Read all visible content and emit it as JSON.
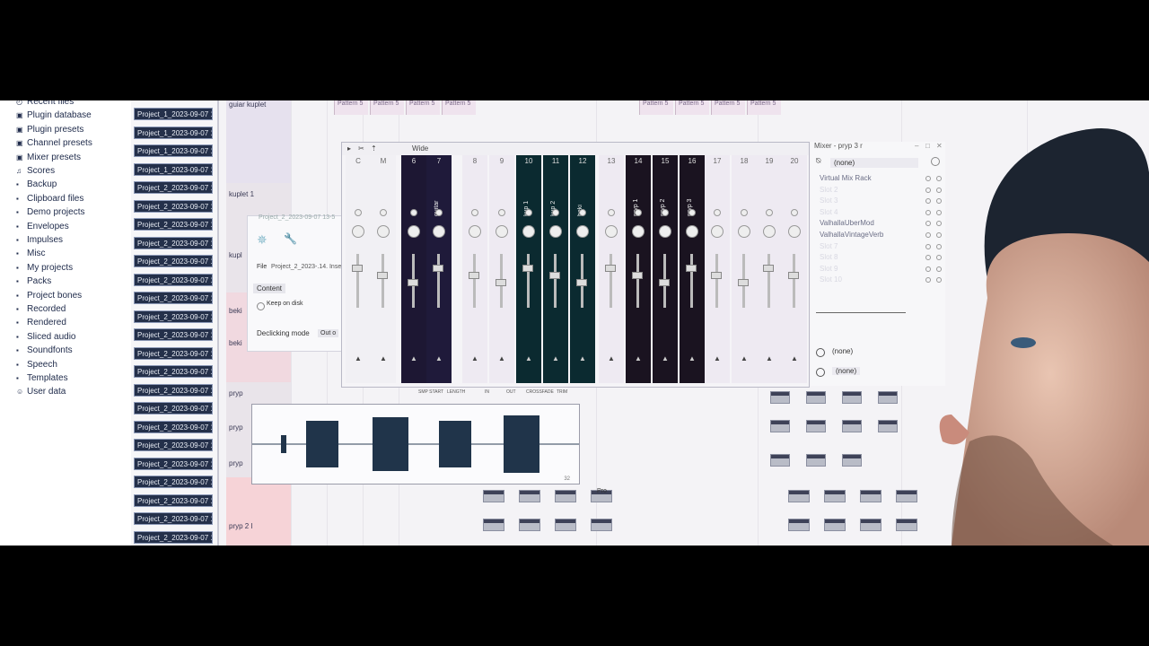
{
  "browser": {
    "items": [
      {
        "label": "Recent files",
        "icon": "clock-icon"
      },
      {
        "label": "Plugin database",
        "icon": "plug-icon"
      },
      {
        "label": "Plugin presets",
        "icon": "plug-icon"
      },
      {
        "label": "Channel presets",
        "icon": "plug-icon"
      },
      {
        "label": "Mixer presets",
        "icon": "plug-icon"
      },
      {
        "label": "Scores",
        "icon": "note-icon"
      },
      {
        "label": "Backup",
        "icon": "folder-icon"
      },
      {
        "label": "Clipboard files",
        "icon": "folder-icon"
      },
      {
        "label": "Demo projects",
        "icon": "folder-icon"
      },
      {
        "label": "Envelopes",
        "icon": "folder-icon"
      },
      {
        "label": "Impulses",
        "icon": "folder-icon"
      },
      {
        "label": "Misc",
        "icon": "folder-icon"
      },
      {
        "label": "My projects",
        "icon": "folder-icon"
      },
      {
        "label": "Packs",
        "icon": "folder-icon"
      },
      {
        "label": "Project bones",
        "icon": "folder-icon"
      },
      {
        "label": "Recorded",
        "icon": "folder-icon"
      },
      {
        "label": "Rendered",
        "icon": "folder-icon"
      },
      {
        "label": "Sliced audio",
        "icon": "folder-icon"
      },
      {
        "label": "Soundfonts",
        "icon": "folder-icon"
      },
      {
        "label": "Speech",
        "icon": "folder-icon"
      },
      {
        "label": "Templates",
        "icon": "folder-icon"
      },
      {
        "label": "User data",
        "icon": "user-icon"
      }
    ]
  },
  "files": [
    "Project_1_2023-09-07 1..",
    "Project_1_2023-09-07 1..",
    "Project_1_2023-09-07 1..",
    "Project_1_2023-09-07 1..",
    "Project_2_2023-09-07 1..",
    "Project_2_2023-09-07 1..",
    "Project_2_2023-09-07 1..",
    "Project_2_2023-09-07 1..",
    "Project_2_2023-09-07 1..",
    "Project_2_2023-09-07 1..",
    "Project_2_2023-09-07 1..",
    "Project_2_2023-09-07 1..",
    "Project_2_2023-09-07 1..",
    "Project_2_2023-09-07 1..",
    "Project_2_2023-09-07 1..",
    "Project_2_2023-09-07 1..",
    "Project_2_2023-09-07 1..",
    "Project_2_2023-09-07 1..",
    "Project_2_2023-09-07 1..",
    "Project_2_2023-09-07 1..",
    "Project_2_2023-09-07 1..",
    "Project_2_2023-09-07 1..",
    "Project_2_2023-09-07 1..",
    "Project_2_2023-09-07 1..",
    "Project_2_2023-09-07 1.."
  ],
  "playlist": {
    "tracks": [
      "guiar kuplet",
      "kuplet 1",
      "kupl",
      "beki",
      "beki",
      "pryp",
      "pryp",
      "pryp",
      "pryp 2 I"
    ],
    "patterns": [
      "Pattern 5",
      "Pattern 5",
      "Pattern 5",
      "Pattern 5",
      "Pattern 5",
      "Pattern 5",
      "Pattern 5",
      "Pattern 5"
    ],
    "clip_label": "Pro"
  },
  "sampler": {
    "title": "Project_2_2023-09-07 13-5",
    "file_label": "File",
    "file_value": "Project_2_2023-.14. Inse",
    "content_label": "Content",
    "keep_on_disk": "Keep on disk",
    "declicking_label": "Declicking mode",
    "declicking_value": "Out o",
    "wave_tabs": [
      "SMP START",
      "LENGTH",
      "IN",
      "OUT",
      "CROSSFADE",
      "TRIM"
    ],
    "wave_number": "32"
  },
  "mixer": {
    "title": "Mixer - pryp 3 r",
    "view_mode": "Wide",
    "strips": [
      {
        "num": "C",
        "name": "",
        "color": "#f1f0f4"
      },
      {
        "num": "M",
        "name": "",
        "color": "#f1f0f4"
      },
      {
        "num": "6",
        "name": "",
        "color": "#1d1733"
      },
      {
        "num": "7",
        "name": "guitar",
        "color": "#1f1a3a"
      },
      {
        "num": "8",
        "name": "",
        "color": "#eeeaf2"
      },
      {
        "num": "9",
        "name": "",
        "color": "#eeeaf2"
      },
      {
        "num": "10",
        "name": "kup 1",
        "color": "#0b2a30"
      },
      {
        "num": "11",
        "name": "kup 2",
        "color": "#0b2a30"
      },
      {
        "num": "12",
        "name": "beki",
        "color": "#0b2a30"
      },
      {
        "num": "13",
        "name": "",
        "color": "#eeeaf2"
      },
      {
        "num": "14",
        "name": "pryp 1",
        "color": "#1a1320"
      },
      {
        "num": "15",
        "name": "pryp 2",
        "color": "#1a1320"
      },
      {
        "num": "16",
        "name": "pryp 3",
        "color": "#1a1320"
      },
      {
        "num": "17",
        "name": "",
        "color": "#eeeaf2"
      },
      {
        "num": "18",
        "name": "",
        "color": "#eeeaf2"
      },
      {
        "num": "19",
        "name": "",
        "color": "#eeeaf2"
      },
      {
        "num": "20",
        "name": "",
        "color": "#eeeaf2"
      }
    ],
    "inserts_preset": "(none)",
    "inserts": [
      "Virtual Mix Rack",
      "Slot 2",
      "Slot 3",
      "Slot 4",
      "ValhallaUberMod",
      "ValhallaVintageVerb",
      "Slot 7",
      "Slot 8",
      "Slot 9",
      "Slot 10"
    ],
    "send_top": "(none)",
    "send_bottom": "(none)"
  }
}
